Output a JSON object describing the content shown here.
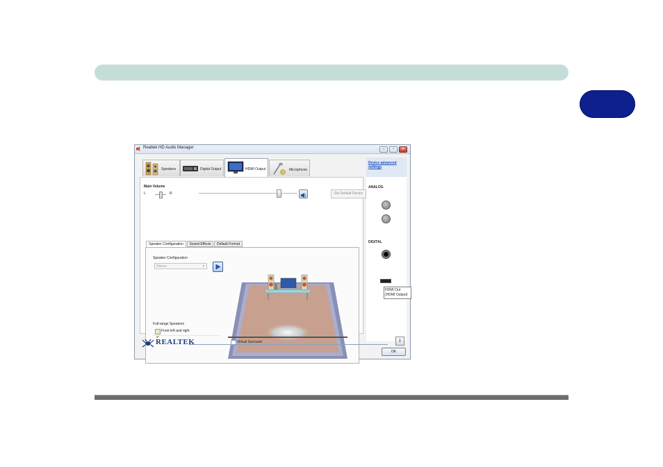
{
  "page": {
    "chapter_tab_label": ""
  },
  "window": {
    "title": "Realtek HD Audio Manager",
    "controls": {
      "minimize": "–",
      "maximize": "▫",
      "close": "✕"
    }
  },
  "device_tabs": [
    {
      "label": "Speakers",
      "icon": "speakers-icon"
    },
    {
      "label": "Digital Output",
      "icon": "digital-output-icon"
    },
    {
      "label": "HDMI Output",
      "icon": "hdmi-monitor-icon",
      "active": true
    },
    {
      "label": "Microphone",
      "icon": "microphone-icon"
    }
  ],
  "volume": {
    "title": "Main Volume",
    "left_label": "L",
    "right_label": "R",
    "level": 0.81,
    "set_default_label": "Set Default Device"
  },
  "sub_tabs": [
    {
      "label": "Speaker Configuration",
      "active": true
    },
    {
      "label": "Sound Effects"
    },
    {
      "label": "Default Format"
    }
  ],
  "speaker_config": {
    "label": "Speaker Configuration",
    "selected": "Stereo",
    "fullrange_title": "Full-range Speakers",
    "front_lr_label": "Front left and right",
    "front_lr_checked": true,
    "virtual_surround_label": "Virtual Surround",
    "virtual_surround_checked": false
  },
  "right_panel": {
    "advanced_link": "Device advanced settings",
    "analog_label": "ANALOG",
    "digital_label": "DIGITAL",
    "tooltip_line1": "HDMI Out",
    "tooltip_line2": "(HDMI Output)"
  },
  "footer": {
    "brand": "REALTEK",
    "info_label": "i",
    "ok_label": "OK"
  },
  "colors": {
    "top_bar": "#c5ddd8",
    "chapter_tab": "#0e1f8e",
    "link_blue": "#1a4dba",
    "floor": "#c8a08f"
  }
}
